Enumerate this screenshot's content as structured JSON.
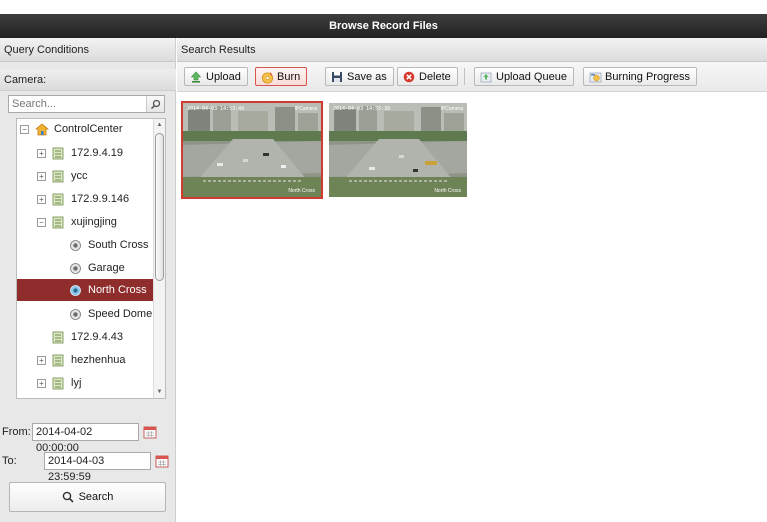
{
  "window": {
    "title": "Browse Record Files"
  },
  "left_panel": {
    "header": "Query Conditions",
    "camera_label": "Camera:",
    "search_placeholder": "Search...",
    "tree": [
      {
        "label": "ControlCenter",
        "type": "root",
        "expander": "−"
      },
      {
        "label": "172.9.4.19",
        "type": "device",
        "expander": "+"
      },
      {
        "label": "ycc",
        "type": "device",
        "expander": "+"
      },
      {
        "label": "172.9.9.146",
        "type": "device",
        "expander": "+"
      },
      {
        "label": "xujingjing",
        "type": "device",
        "expander": "−"
      },
      {
        "label": "South Cross",
        "type": "camera"
      },
      {
        "label": "Garage",
        "type": "camera"
      },
      {
        "label": "North Cross",
        "type": "camera",
        "selected": true
      },
      {
        "label": "Speed Dome",
        "type": "camera"
      },
      {
        "label": "172.9.4.43",
        "type": "device"
      },
      {
        "label": "hezhenhua",
        "type": "device",
        "expander": "+"
      },
      {
        "label": "lyj",
        "type": "device",
        "expander": "+"
      }
    ],
    "from_label": "From:",
    "from_value": "2014-04-02 00:00:00",
    "to_label": "To:",
    "to_value": "2014-04-03 23:59:59",
    "search_button": "Search"
  },
  "right_panel": {
    "header": "Search Results",
    "toolbar": {
      "upload": "Upload",
      "burn": "Burn",
      "save_as": "Save as",
      "delete": "Delete",
      "upload_queue": "Upload Queue",
      "burning_progress": "Burning Progress"
    },
    "results": [
      {
        "timestamp": "2014-04-03 14:53:40",
        "camera_overlay": "IPCamera",
        "name_overlay": "North Cross",
        "selected": true
      },
      {
        "timestamp": "2014-04-03 14:55:38",
        "camera_overlay": "IPCamera",
        "name_overlay": "North Cross",
        "selected": false
      }
    ]
  },
  "colors": {
    "title_bar": "#2c2c2c",
    "selected_row": "#8f2c2c",
    "selected_thumb_border": "#d23a32"
  }
}
